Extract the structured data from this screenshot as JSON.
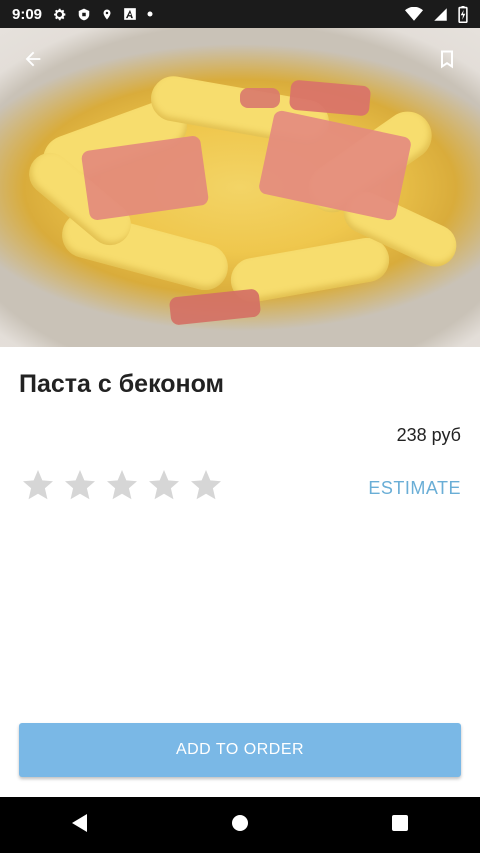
{
  "status_bar": {
    "time": "9:09",
    "left_icons": [
      "gear-icon",
      "shield-icon",
      "location-icon",
      "a-icon",
      "dot-icon"
    ],
    "right_icons": [
      "wifi-icon",
      "signal-icon",
      "battery-icon"
    ]
  },
  "header": {
    "back_icon": "arrow-back-icon",
    "bookmark_icon": "bookmark-icon"
  },
  "product": {
    "title": "Паста с беконом",
    "price": "238 руб",
    "rating": {
      "value": 0,
      "max": 5
    },
    "estimate_label": "ESTIMATE",
    "add_to_order_label": "ADD TO ORDER"
  },
  "colors": {
    "accent": "#6aaed6",
    "button": "#7ab8e6",
    "star_empty": "#d6d6d6"
  },
  "nav_bar": {
    "buttons": [
      "back-triangle-icon",
      "home-circle-icon",
      "recents-square-icon"
    ]
  }
}
